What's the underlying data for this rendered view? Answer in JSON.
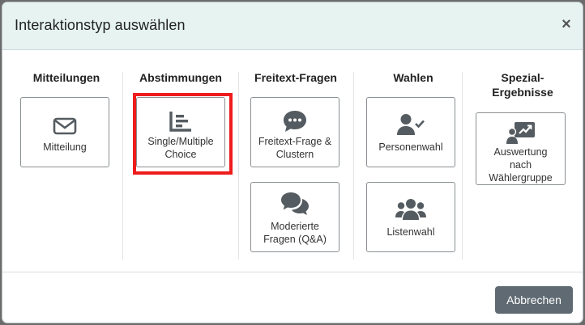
{
  "dialog": {
    "title": "Interaktionstyp auswählen",
    "close_glyph": "×",
    "cancel_label": "Abbrechen"
  },
  "columns": [
    {
      "title": "Mitteilungen",
      "tiles": [
        {
          "label": "Mitteilung",
          "icon": "envelope-icon"
        }
      ]
    },
    {
      "title": "Abstimmungen",
      "tiles": [
        {
          "label": "Single/Multiple Choice",
          "icon": "bar-list-icon"
        }
      ]
    },
    {
      "title": "Freitext-Fragen",
      "tiles": [
        {
          "label": "Freitext-Frage & Clustern",
          "icon": "comment-dots-icon"
        },
        {
          "label": "Moderierte Fragen (Q&A)",
          "icon": "comments-icon"
        }
      ]
    },
    {
      "title": "Wahlen",
      "tiles": [
        {
          "label": "Personenwahl",
          "icon": "user-check-icon"
        },
        {
          "label": "Listenwahl",
          "icon": "users-icon"
        }
      ]
    },
    {
      "title": "Spezial-Ergebnisse",
      "tiles": [
        {
          "label": "Auswertung nach Wählergruppe",
          "icon": "chart-person-icon"
        }
      ]
    }
  ],
  "colors": {
    "highlight": "#ee1c1c",
    "header_bg": "#e6f3f1",
    "icon": "#555c61",
    "button_bg": "#5f6a72"
  }
}
